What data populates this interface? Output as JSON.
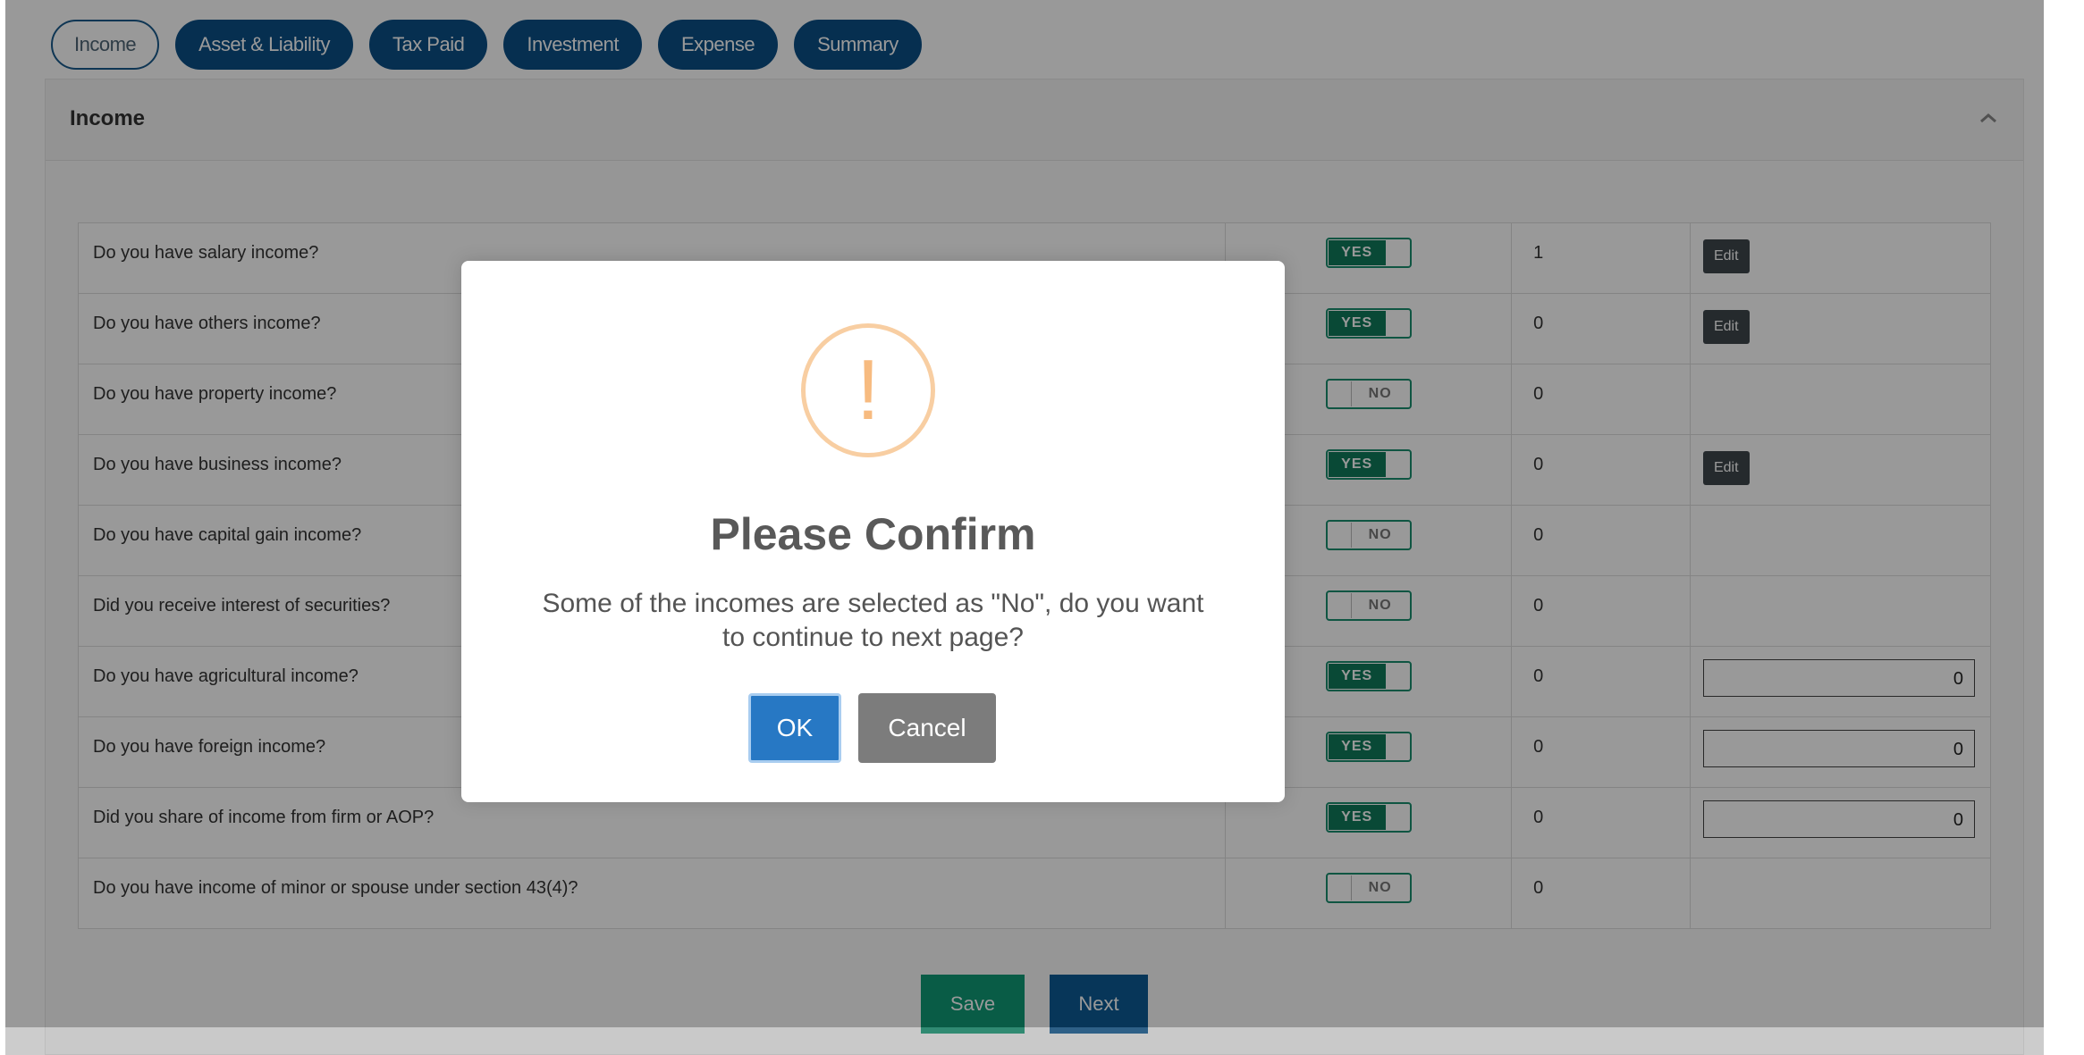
{
  "tabs": [
    {
      "label": "Income",
      "active": true
    },
    {
      "label": "Asset & Liability"
    },
    {
      "label": "Tax Paid"
    },
    {
      "label": "Investment"
    },
    {
      "label": "Expense"
    },
    {
      "label": "Summary"
    }
  ],
  "panel": {
    "title": "Income",
    "chevron_icon": "chevron-up-icon"
  },
  "rows": [
    {
      "question": "Do you have salary income?",
      "toggle": "YES",
      "count": "1",
      "action": "Edit"
    },
    {
      "question": "Do you have others income?",
      "toggle": "YES",
      "count": "0",
      "action": "Edit"
    },
    {
      "question": "Do you have property income?",
      "toggle": "NO",
      "count": "0"
    },
    {
      "question": "Do you have business income?",
      "toggle": "YES",
      "count": "0",
      "action": "Edit"
    },
    {
      "question": "Do you have capital gain income?",
      "toggle": "NO",
      "count": "0"
    },
    {
      "question": "Did you receive interest of securities?",
      "toggle": "NO",
      "count": "0"
    },
    {
      "question": "Do you have agricultural income?",
      "toggle": "YES",
      "count": "0",
      "amount": "0"
    },
    {
      "question": "Do you have foreign income?",
      "toggle": "YES",
      "count": "0",
      "amount": "0"
    },
    {
      "question": "Did you share of income from firm or AOP?",
      "toggle": "YES",
      "count": "0",
      "amount": "0"
    },
    {
      "question": "Do you have income of minor or spouse under section 43(4)?",
      "toggle": "NO",
      "count": "0"
    }
  ],
  "buttons": {
    "save": "Save",
    "next": "Next"
  },
  "modal": {
    "icon": "exclamation-icon",
    "icon_glyph": "!",
    "title": "Please Confirm",
    "message": "Some of the incomes are selected as \"No\", do you want to continue to next page?",
    "ok": "OK",
    "cancel": "Cancel"
  },
  "colors": {
    "primary": "#0b4f86",
    "save": "#109a76",
    "toggle_on": "#0f7a5b",
    "ok": "#2778c4",
    "warning": "#f8bb86"
  }
}
